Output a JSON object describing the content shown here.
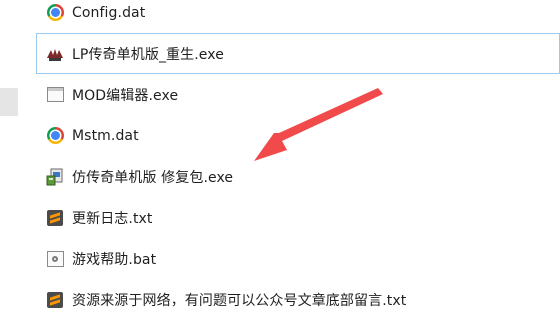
{
  "files": [
    {
      "name": "Config.dat",
      "icon": "chrome-icon"
    },
    {
      "name": "LP传奇单机版_重生.exe",
      "icon": "lp-app-icon"
    },
    {
      "name": "MOD编辑器.exe",
      "icon": "app-window-icon"
    },
    {
      "name": "Mstm.dat",
      "icon": "chrome-icon"
    },
    {
      "name": "仿传奇单机版 修复包.exe",
      "icon": "installer-icon"
    },
    {
      "name": "更新日志.txt",
      "icon": "sublime-icon"
    },
    {
      "name": "游戏帮助.bat",
      "icon": "batch-file-icon"
    },
    {
      "name": "资源来源于网络，有问题可以公众号文章底部留言.txt",
      "icon": "sublime-icon"
    }
  ],
  "annotation": {
    "color": "#f04a4a"
  }
}
